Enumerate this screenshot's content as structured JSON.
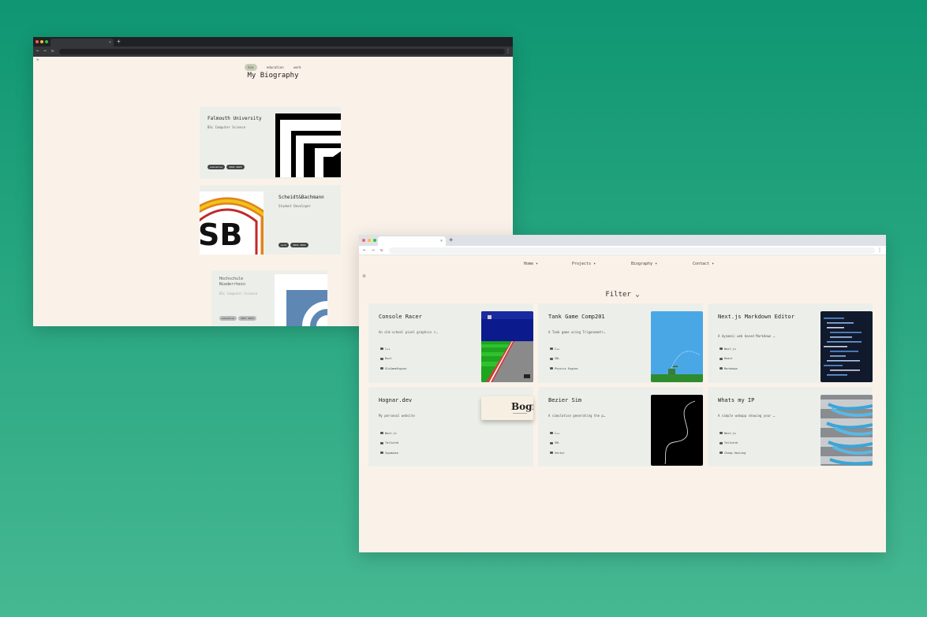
{
  "back_window": {
    "nav": [
      "bio",
      "education",
      "work"
    ],
    "title": "My Biography",
    "cards": [
      {
        "title": "Falmouth University",
        "subtitle": "BSc Computer Science",
        "tags": [
          "education",
          "2022 2025"
        ]
      },
      {
        "title": "Scheidt&Bachmann",
        "subtitle": "Student Developer",
        "tags": [
          "work",
          "2019 2022"
        ]
      },
      {
        "title": "Hochschule Niederrhein",
        "subtitle": "BSc Computer Science",
        "tags": [
          "education",
          "2017 2019"
        ]
      }
    ]
  },
  "front_window": {
    "nav": [
      "Home ▾",
      "Projects ▾",
      "Biography ▾",
      "Contact ▾"
    ],
    "filter_label": "Filter ⌄",
    "projects": [
      {
        "title": "Console Racer",
        "description": "An old-school pixel graphics r…",
        "techs": [
          "C++",
          "Rust",
          "OlcGameEngine"
        ]
      },
      {
        "title": "Tank Game Comp201",
        "description": "A Tank game using Trigonometr…",
        "techs": [
          "C++",
          "SDL",
          "Physics Engine"
        ]
      },
      {
        "title": "Next.js Markdown Editor",
        "description": "A dynamic web based Markdown …",
        "techs": [
          "Next.js",
          "React",
          "Markdown"
        ]
      },
      {
        "title": "Hognar.dev",
        "description": "My personal website",
        "techs": [
          "Next.js",
          "Tailwind",
          "Supabase"
        ]
      },
      {
        "title": "Bezier Sim",
        "description": "A simulation generating the p…",
        "techs": [
          "C++",
          "SDL",
          "Vector"
        ]
      },
      {
        "title": "Whats my IP",
        "description": "A simple webapp showing your …",
        "techs": [
          "Next.js",
          "Tailwind",
          "Cheap Hosting"
        ]
      }
    ],
    "hognar_logo_text": "Bogn"
  },
  "colors": {
    "background_top": "#0f9672",
    "background_bottom": "#46b892",
    "page": "#faf2e9",
    "card": "#ecefe9"
  }
}
